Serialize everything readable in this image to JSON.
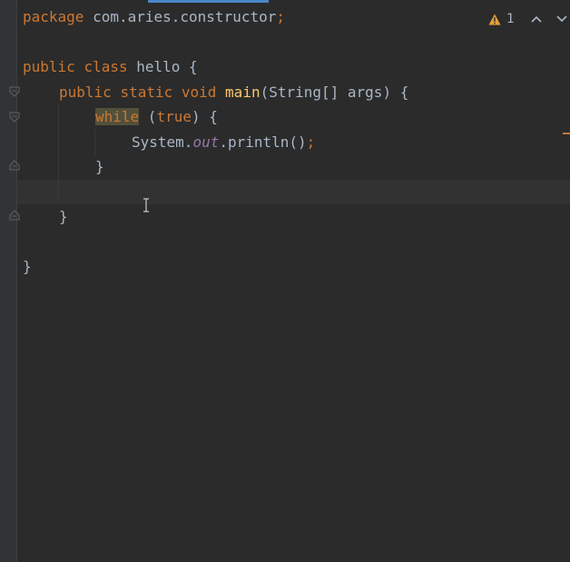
{
  "code": {
    "line1": {
      "kw": "package",
      "rest": " com.aries.constructor",
      "semi": ";"
    },
    "line3": {
      "kw1": "public",
      "sp1": " ",
      "kw2": "class",
      "rest": " hello {"
    },
    "line4": {
      "kw1": "public",
      "sp1": " ",
      "kw2": "static",
      "sp2": " ",
      "kw3": "void",
      "sp3": " ",
      "fn": "main",
      "rest": "(String[] args) {"
    },
    "line5": {
      "kw": "while",
      "rest1": " (",
      "kw2": "true",
      "rest2": ") {"
    },
    "line6": {
      "pre": "System.",
      "it": "out",
      "post": ".println()",
      "semi": ";"
    },
    "line7": {
      "text": "}"
    },
    "line9": {
      "text": "}"
    },
    "line11": {
      "text": "}"
    }
  },
  "inspection": {
    "warning_count": "1",
    "icon": "warning-triangle-icon"
  },
  "colors": {
    "keyword": "#cc7832",
    "function": "#ffc66d",
    "field": "#9876aa",
    "text": "#a9b7c6",
    "background": "#2b2b2b"
  }
}
